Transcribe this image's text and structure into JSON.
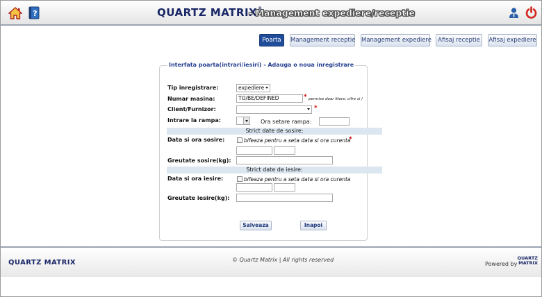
{
  "header": {
    "brand": "QUARTZ MATRIX",
    "brand_mark": "®",
    "subtitle": "- Management expediere/receptie"
  },
  "nav": {
    "items": [
      {
        "label": "Poarta",
        "active": true
      },
      {
        "label": "Management receptie",
        "active": false
      },
      {
        "label": "Management expediere",
        "active": false
      },
      {
        "label": "Afisaj receptie",
        "active": false
      },
      {
        "label": "Afisaj expediere",
        "active": false
      }
    ]
  },
  "form": {
    "title": "Interfata poarta(intrari/iesiri) - Adauga o noua inregistrare",
    "tip_label": "Tip inregistrare:",
    "tip_value": "expediere",
    "numar_label": "Numar masina:",
    "numar_value": "TO/BE/DEFINED",
    "numar_hint": "permise doar litere, cifre si /",
    "client_label": "Client/Furnizor:",
    "client_value": "",
    "intrare_label": "Intrare la rampa:",
    "ora_rampa_label": "Ora setare rampa:",
    "ora_rampa_value": "",
    "sosire_band": "Strict date de sosire:",
    "data_sosire_label": "Data si ora sosire:",
    "sosire_check_label": "bifeaza pentru a seta data si ora curenta",
    "greutate_sosire_label": "Greutate sosire(kg):",
    "iesire_band": "Strict date de iesire:",
    "data_iesire_label": "Data si ora iesire:",
    "iesire_check_label": "bifeaza pentru a seta data si ora curenta",
    "greutate_iesire_label": "Greutate iesire(kg):",
    "required_mark": "*",
    "save_label": "Salveaza",
    "back_label": "Inapoi"
  },
  "footer": {
    "brand": "QUARTZ MATRIX",
    "copyright": "© Quartz Matrix | All rights reserved",
    "powered_by": "Powered by",
    "mini_logo_line1": "QUARTZ",
    "mini_logo_line2": "MATRIX"
  },
  "colors": {
    "brand": "#1a2766",
    "accent": "#1f4d99",
    "required": "#cc0000",
    "band": "#dce6f0"
  },
  "icons": [
    "home-icon",
    "help-book-icon",
    "user-icon",
    "power-icon"
  ]
}
